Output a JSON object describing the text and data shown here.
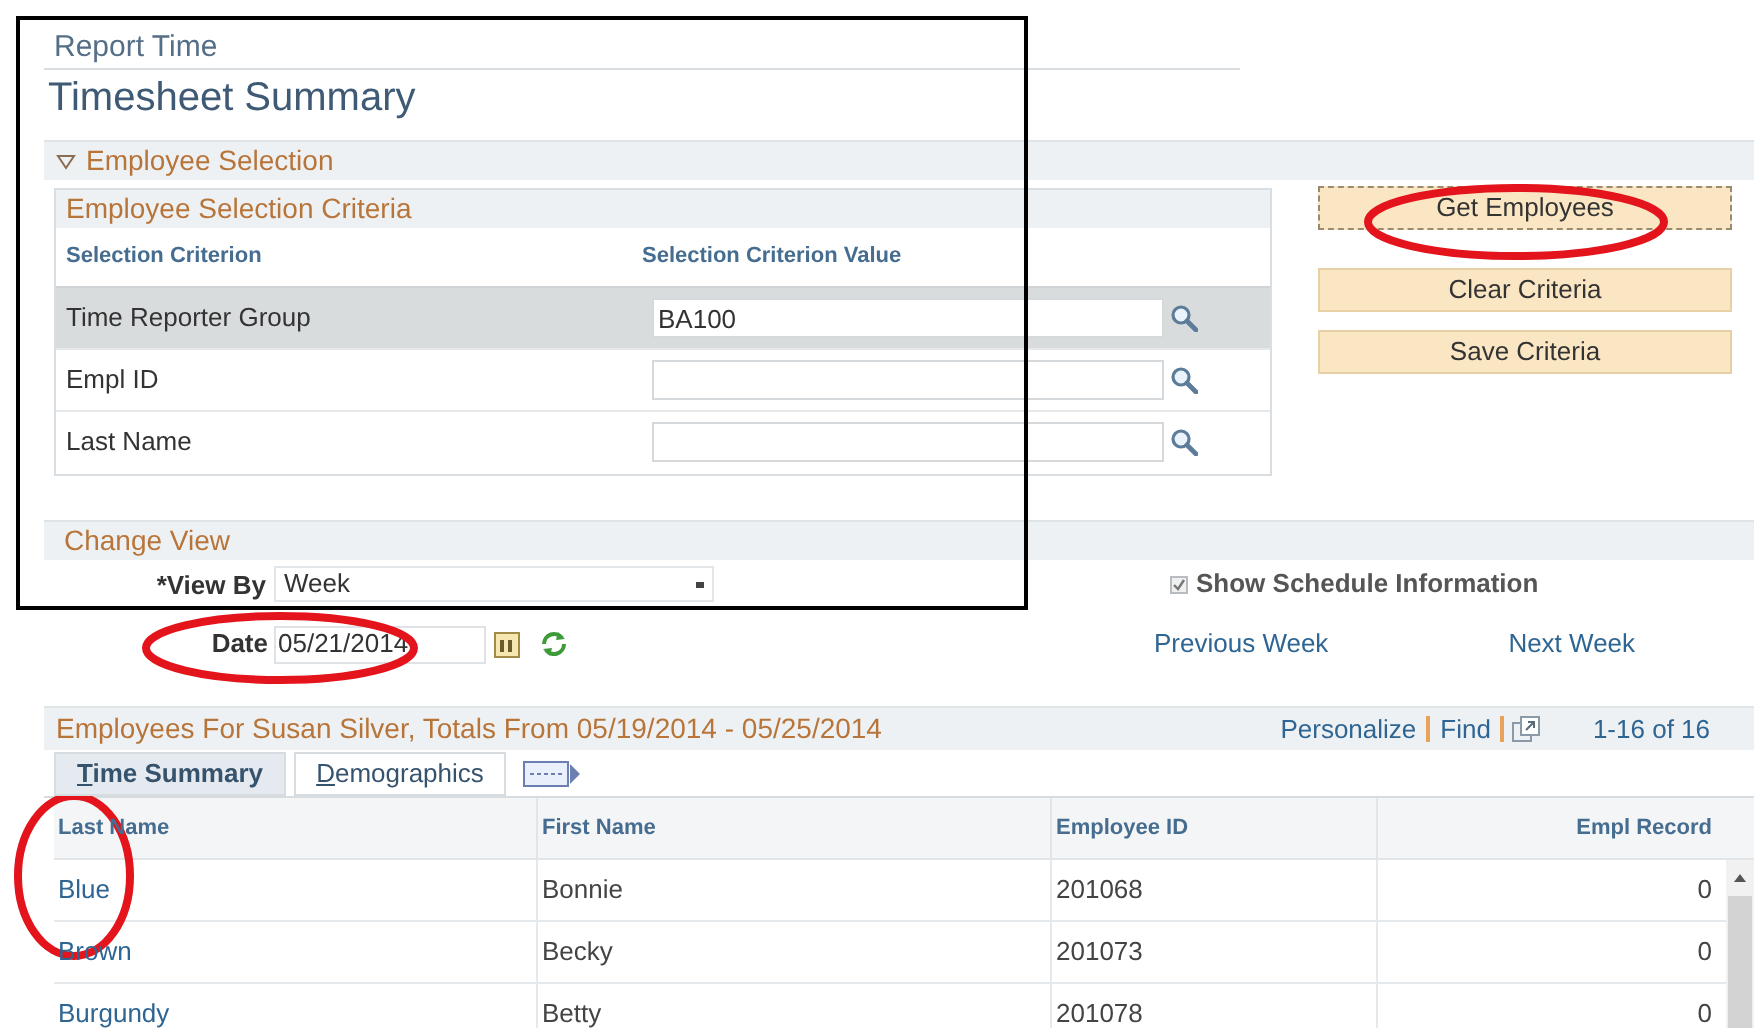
{
  "breadcrumb": "Report Time",
  "title": "Timesheet Summary",
  "employee_selection": {
    "header": "Employee Selection",
    "expanded": true,
    "criteria_title": "Employee Selection Criteria",
    "columns": [
      "Selection Criterion",
      "Selection Criterion Value"
    ],
    "rows": [
      {
        "label": "Time Reporter Group",
        "value": "BA100",
        "selected": true
      },
      {
        "label": "Empl ID",
        "selected": false
      },
      {
        "label": "Last Name",
        "selected": false
      }
    ],
    "buttons": [
      {
        "label": "Get Employees",
        "focused": true
      },
      {
        "label": "Clear Criteria",
        "focused": false
      },
      {
        "label": "Save Criteria",
        "focused": false
      }
    ]
  },
  "change_view": {
    "header": "Change View",
    "view_by": {
      "label": "*View By",
      "value": "Week"
    },
    "show_schedule": {
      "label": "Show Schedule Information",
      "checked": true
    },
    "date": {
      "label": "Date",
      "value": "05/21/2014"
    },
    "previous": "Previous Week",
    "next": "Next Week"
  },
  "grid": {
    "title": "Employees For Susan Silver, Totals From 05/19/2014 - 05/25/2014",
    "links": [
      "Personalize",
      "Find"
    ],
    "count": "1-16 of 16",
    "tabs": [
      {
        "label": "Time Summary",
        "selected": true
      },
      {
        "label": "Demographics",
        "selected": false
      }
    ],
    "columns": [
      "Last Name",
      "First Name",
      "Employee ID",
      "Empl Record"
    ],
    "rows": [
      {
        "last_name": "Blue",
        "first_name": "Bonnie",
        "employee_id": "201068",
        "empl_record": "0"
      },
      {
        "last_name": "Brown",
        "first_name": "Becky",
        "employee_id": "201073",
        "empl_record": "0"
      },
      {
        "last_name": "Burgundy",
        "first_name": "Betty",
        "employee_id": "201078",
        "empl_record": "0"
      }
    ]
  },
  "annotations": [
    {
      "kind": "frame",
      "color": "#000000"
    },
    {
      "kind": "ellipse",
      "color": "#e3141b"
    },
    {
      "kind": "ellipse",
      "color": "#e3141b"
    },
    {
      "kind": "ellipse",
      "color": "#e3141b"
    }
  ]
}
